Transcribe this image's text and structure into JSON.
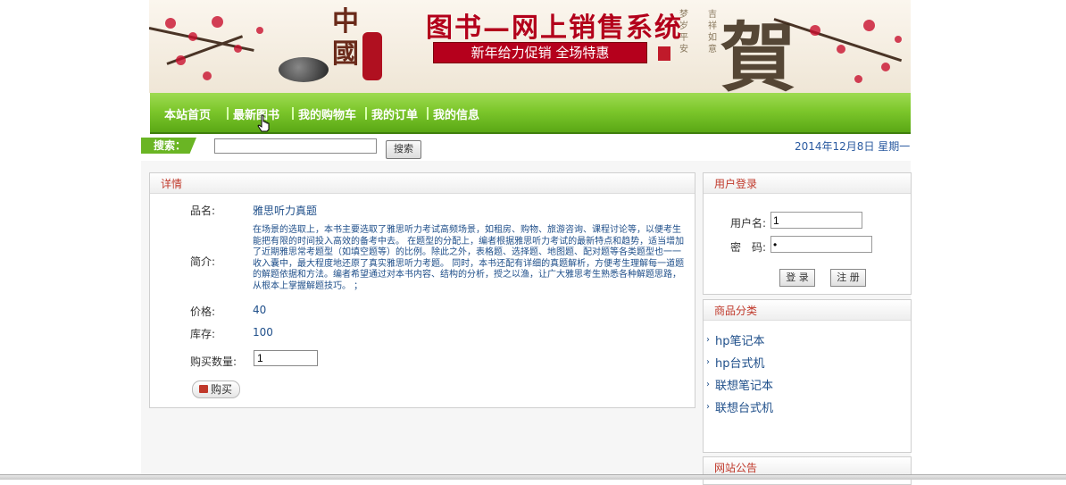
{
  "banner": {
    "logo_chars": [
      "中",
      "國"
    ],
    "title": "图书—网上销售系统",
    "promo": "新年给力促销 全场特惠",
    "poem_lines": [
      "梦",
      "岁",
      "平",
      "安",
      "吉",
      "祥",
      "如",
      "意"
    ],
    "he_char": "賀"
  },
  "nav": {
    "items": [
      "本站首页",
      "最新图书",
      "我的购物车",
      "我的订单",
      "我的信息"
    ]
  },
  "search": {
    "label": "搜索：",
    "value": "",
    "button": "搜索"
  },
  "date": "2014年12月8日 星期一",
  "detail": {
    "header": "详情",
    "name_label": "品名:",
    "name": "雅思听力真题",
    "desc_label": "简介:",
    "desc": "在场景的选取上，本书主要选取了雅思听力考试高频场景，如租房、购物、旅游咨询、课程讨论等，以便考生能把有限的时间投入高效的备考中去。 在题型的分配上，编者根据雅思听力考试的最新特点和趋势，适当增加了近期雅思常考题型（如填空题等）的比例。除此之外，表格题、选择题、地图题、配对题等各类题型也一一收入囊中，最大程度地还原了真实雅思听力考题。 同时，本书还配有详细的真题解析，方便考生理解每一道题的解题依据和方法。编者希望通过对本书内容、结构的分析，授之以渔，让广大雅思考生熟悉各种解题思路，从根本上掌握解题技巧。 ；",
    "price_label": "价格:",
    "price": "40",
    "stock_label": "库存:",
    "stock": "100",
    "qty_label": "购买数量:",
    "qty": "1",
    "buy_button": "购买"
  },
  "login": {
    "header": "用户登录",
    "user_label": "用户名:",
    "user_value": "1",
    "pwd_label": "密　码:",
    "pwd_value": "•",
    "login_button": "登 录",
    "register_button": "注 册"
  },
  "categories": {
    "header": "商品分类",
    "items": [
      "hp笔记本",
      "hp台式机",
      "联想笔记本",
      "联想台式机"
    ]
  },
  "notice": {
    "header": "网站公告"
  },
  "colors": {
    "nav_green": "#7dc72c",
    "title_red": "#b3001b",
    "link_blue": "#1f4f8a",
    "header_red": "#c0392b"
  }
}
